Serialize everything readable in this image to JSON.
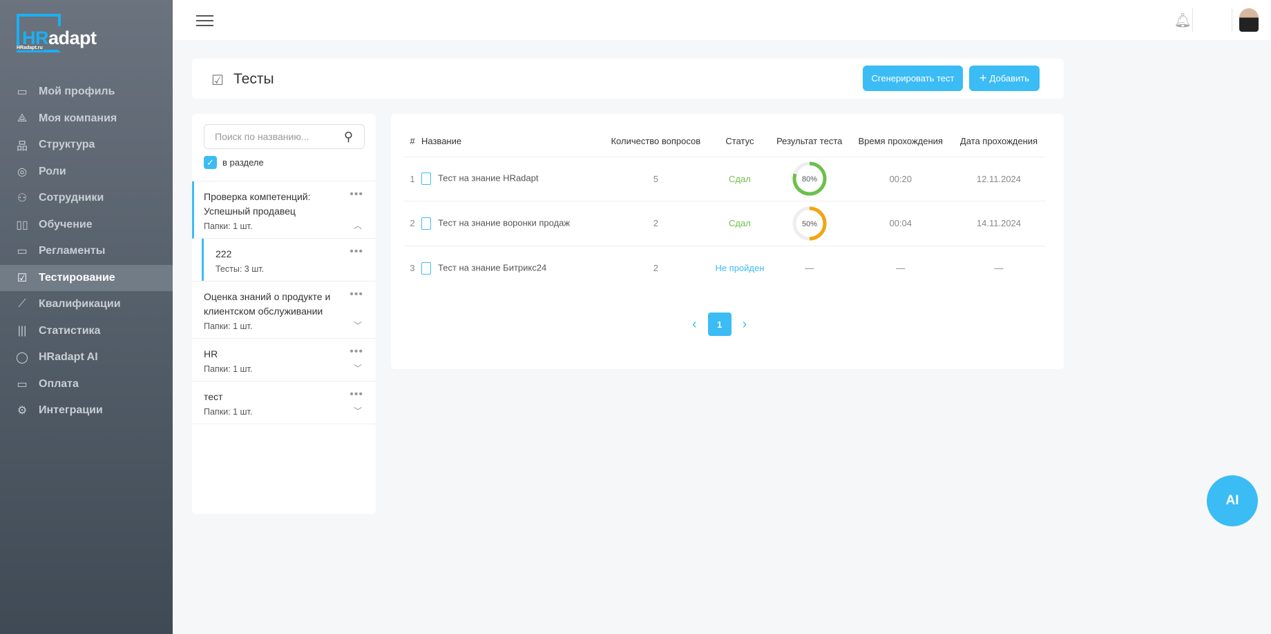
{
  "logo": {
    "a": "HR",
    "b": "adapt",
    "site": "HRadapt.ru"
  },
  "nav": [
    {
      "icon": "briefcase-icon",
      "glyph": "▭",
      "label": "Мой профиль"
    },
    {
      "icon": "company-icon",
      "glyph": "⟁",
      "label": "Моя компания"
    },
    {
      "icon": "structure-icon",
      "glyph": "品",
      "label": "Структура"
    },
    {
      "icon": "user-circle-icon",
      "glyph": "◎",
      "label": "Роли"
    },
    {
      "icon": "users-icon",
      "glyph": "⚇",
      "label": "Сотрудники"
    },
    {
      "icon": "book-icon",
      "glyph": "▯▯",
      "label": "Обучение"
    },
    {
      "icon": "folder-icon",
      "glyph": "▭",
      "label": "Регламенты"
    },
    {
      "icon": "checklist-icon",
      "glyph": "☑",
      "label": "Тестирование",
      "active": true
    },
    {
      "icon": "chart-line-icon",
      "glyph": "⟋",
      "label": "Квалификации"
    },
    {
      "icon": "bars-icon",
      "glyph": "|||",
      "label": "Статистика"
    },
    {
      "icon": "chat-icon",
      "glyph": "◯",
      "label": "HRadapt AI"
    },
    {
      "icon": "card-icon",
      "glyph": "▭",
      "label": "Оплата"
    },
    {
      "icon": "gear-icon",
      "glyph": "⚙",
      "label": "Интеграции"
    }
  ],
  "header": {
    "title": "Тесты",
    "generate": "Сгенерировать тест",
    "add": "Добавить",
    "add_glyph": "+"
  },
  "search": {
    "placeholder": "Поиск по названию...",
    "in_section": "в разделе",
    "checked": true
  },
  "folders": [
    {
      "name": "Проверка компетенций: Успешный продавец",
      "count": "Папки: 1 шт.",
      "expanded": true,
      "sub": [
        {
          "name": "222",
          "count": "Тесты: 3 шт."
        }
      ]
    },
    {
      "name": "Оценка знаний о продукте и клиентском обслуживании",
      "count": "Папки: 1 шт."
    },
    {
      "name": "HR",
      "count": "Папки: 1 шт."
    },
    {
      "name": "тест",
      "count": "Папки: 1 шт."
    }
  ],
  "table": {
    "headers": [
      "#",
      "Название",
      "Количество вопросов",
      "Статус",
      "Результат теста",
      "Время прохождения",
      "Дата прохождения"
    ],
    "rows": [
      {
        "n": "1",
        "name": "Тест на знание HRadapt",
        "q": "5",
        "status": "Сдал",
        "result": 80,
        "result_label": "80%",
        "color": "#6cc04a",
        "time": "00:20",
        "date": "12.11.2024"
      },
      {
        "n": "2",
        "name": "Тест на знание воронки продаж",
        "q": "2",
        "status": "Сдал",
        "result": 50,
        "result_label": "50%",
        "color": "#f5a30e",
        "time": "00:04",
        "date": "14.11.2024"
      },
      {
        "n": "3",
        "name": "Тест на знание Битрикс24",
        "q": "2",
        "status": "Не пройден",
        "result": null,
        "result_label": "—",
        "time": "—",
        "date": "—"
      }
    ]
  },
  "pagination": {
    "page": "1",
    "prev": "‹",
    "next": "›"
  },
  "ai_button": "AI"
}
